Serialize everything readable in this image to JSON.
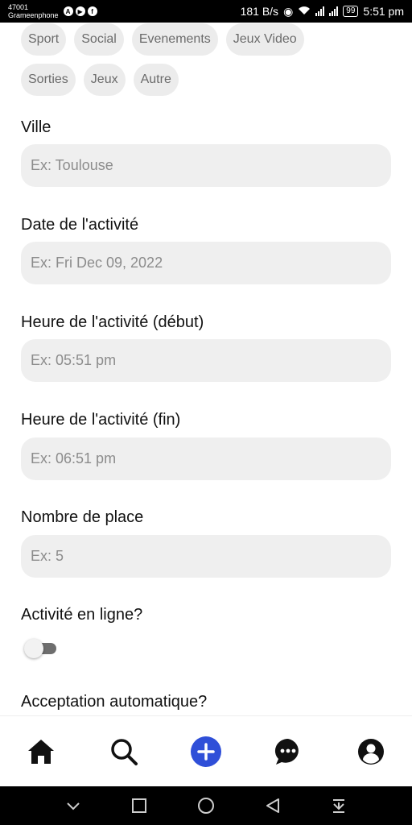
{
  "status_bar": {
    "carrier_code": "47001",
    "carrier_name": "Grameenphone",
    "net_speed": "181 B/s",
    "battery": "99",
    "time": "5:51 pm"
  },
  "categories": {
    "row1": [
      "Sport",
      "Social",
      "Evenements",
      "Jeux Video"
    ],
    "row2": [
      "Sorties",
      "Jeux",
      "Autre"
    ]
  },
  "form": {
    "city": {
      "label": "Ville",
      "placeholder": "Ex: Toulouse"
    },
    "date": {
      "label": "Date de l'activité",
      "placeholder": "Ex: Fri Dec 09, 2022"
    },
    "start_time": {
      "label": "Heure de l'activité (début)",
      "placeholder": "Ex: 05:51 pm"
    },
    "end_time": {
      "label": "Heure de l'activité (fin)",
      "placeholder": "Ex: 06:51 pm"
    },
    "seats": {
      "label": "Nombre de place",
      "placeholder": "Ex: 5"
    },
    "online": {
      "label": "Activité en ligne?",
      "value": false
    },
    "auto_accept": {
      "label": "Acceptation automatique?"
    }
  },
  "bottom_nav": {
    "items": [
      "home-icon",
      "search-icon",
      "add-icon",
      "chat-icon",
      "profile-icon"
    ],
    "accent": "#2f4fd8"
  }
}
